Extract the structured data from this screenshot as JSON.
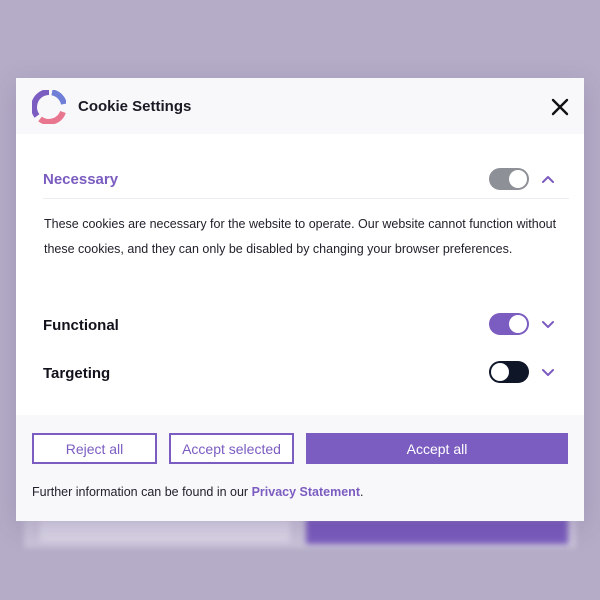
{
  "colors": {
    "accent": "#7b5cc0",
    "toggle_on": "#7b5cc0",
    "toggle_disabled": "#8e9097",
    "toggle_off": "#0f1628",
    "overlay": "#b5adc7"
  },
  "modal": {
    "title": "Cookie Settings",
    "logo_icon": "donut-ring-logo-icon",
    "close_icon": "close-icon"
  },
  "sections": {
    "necessary": {
      "label": "Necessary",
      "enabled": true,
      "locked": true,
      "expanded": true,
      "description": "These cookies are necessary for the website to operate. Our website cannot function without these cookies, and they can only be disabled by changing your browser preferences."
    },
    "functional": {
      "label": "Functional",
      "enabled": true,
      "expanded": false
    },
    "targeting": {
      "label": "Targeting",
      "enabled": false,
      "expanded": false
    }
  },
  "footer": {
    "reject_label": "Reject all",
    "accept_selected_label": "Accept selected",
    "accept_all_label": "Accept all",
    "note_prefix": "Further information can be found in our",
    "note_link": "Privacy Statement",
    "note_suffix": "."
  }
}
